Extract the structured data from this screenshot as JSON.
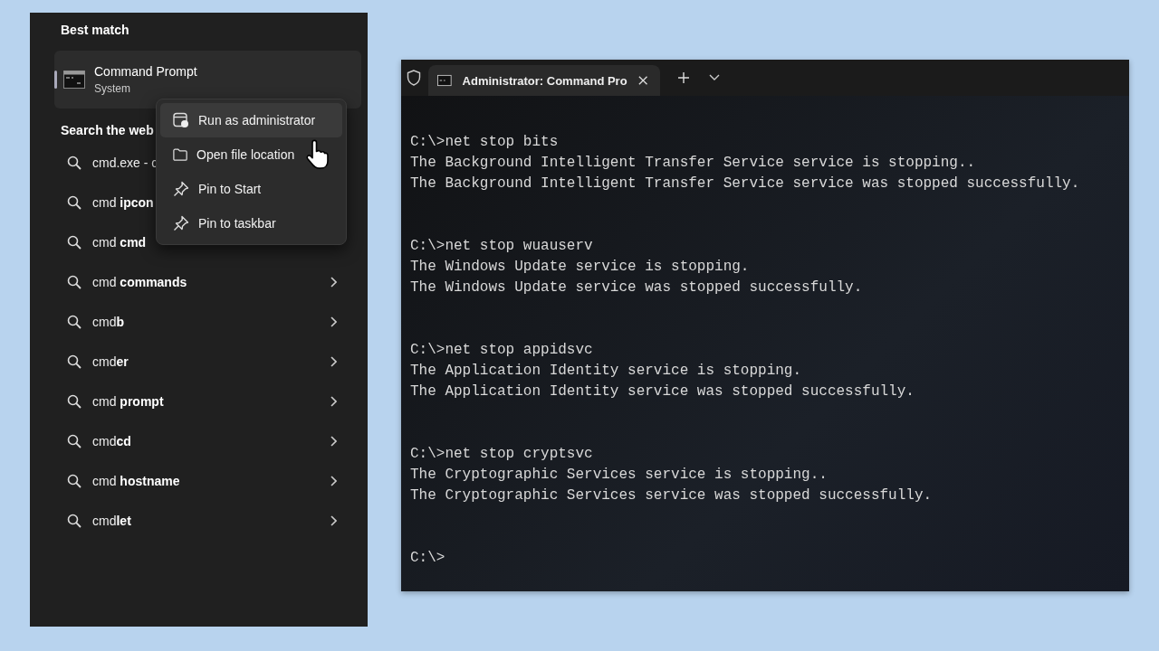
{
  "search_panel": {
    "best_match_heading": "Best match",
    "best_match": {
      "title": "Command Prompt",
      "subtitle": "System",
      "selected": true
    },
    "web_heading": "Search the web",
    "results": [
      {
        "label": "cmd.exe - c"
      },
      {
        "label": "cmd **ipcon**"
      },
      {
        "label": "cmd **cmd**"
      },
      {
        "label": "cmd **commands**",
        "has_arrow": true
      },
      {
        "label": "cmd**b**",
        "has_arrow": true
      },
      {
        "label": "cmd**er**",
        "has_arrow": true
      },
      {
        "label": "cmd **prompt**",
        "has_arrow": true
      },
      {
        "label": "cmd**cd**",
        "has_arrow": true
      },
      {
        "label": "cmd **hostname**",
        "has_arrow": true
      },
      {
        "label": "cmd**let**",
        "has_arrow": true
      }
    ]
  },
  "context_menu": {
    "items": [
      {
        "kind": "admin",
        "label": "Run as administrator",
        "highlighted": true
      },
      {
        "kind": "folder",
        "label": "Open file location",
        "highlighted": false
      },
      {
        "kind": "pin",
        "label": "Pin to Start",
        "highlighted": false
      },
      {
        "kind": "pin",
        "label": "Pin to taskbar",
        "highlighted": false
      }
    ]
  },
  "terminal": {
    "tab": {
      "title": "Administrator: Command Pro",
      "selected": true
    },
    "blocks": [
      {
        "command": "C:\\>net stop bits",
        "output": [
          "The Background Intelligent Transfer Service service is stopping..",
          "The Background Intelligent Transfer Service service was stopped successfully."
        ]
      },
      {
        "command": "C:\\>net stop wuauserv",
        "output": [
          "The Windows Update service is stopping.",
          "The Windows Update service was stopped successfully."
        ]
      },
      {
        "command": "C:\\>net stop appidsvc",
        "output": [
          "The Application Identity service is stopping.",
          "The Application Identity service was stopped successfully."
        ]
      },
      {
        "command": "C:\\>net stop cryptsvc",
        "output": [
          "The Cryptographic Services service is stopping..",
          "The Cryptographic Services service was stopped successfully."
        ]
      }
    ],
    "prompt": "C:\\>"
  }
}
